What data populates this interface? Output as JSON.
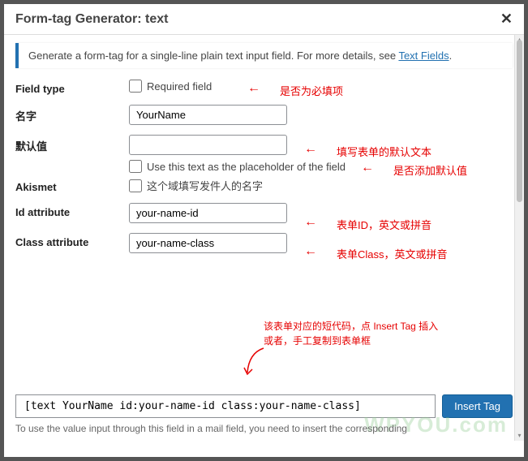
{
  "dialog": {
    "title": "Form-tag Generator: text",
    "close": "✕"
  },
  "notice": {
    "text": "Generate a form-tag for a single-line plain text input field. For more details, see ",
    "link": "Text Fields",
    "suffix": "."
  },
  "fields": {
    "fieldtype": {
      "label": "Field type",
      "checkbox_label": "Required field"
    },
    "name": {
      "label": "名字",
      "value": "YourName"
    },
    "default": {
      "label": "默认值",
      "value": "",
      "placeholder_checkbox": "Use this text as the placeholder of the field"
    },
    "akismet": {
      "label": "Akismet",
      "checkbox_label": "这个域填写发件人的名字"
    },
    "idattr": {
      "label": "Id attribute",
      "value": "your-name-id"
    },
    "classattr": {
      "label": "Class attribute",
      "value": "your-name-class"
    }
  },
  "annotations": {
    "required": "是否为必填项",
    "default_text": "填写表单的默认文本",
    "placeholder": "是否添加默认值",
    "id": "表单ID，英文或拼音",
    "class": "表单Class，英文或拼音",
    "shortcode_line1": "该表单对应的短代码，点 Insert Tag 插入",
    "shortcode_line2": "或者，手工复制到表单框"
  },
  "footer": {
    "tag": "[text YourName id:your-name-id class:your-name-class]",
    "button": "Insert Tag"
  },
  "cutoff_text": "To use the value input through this field in a mail field, you need to insert the corresponding",
  "watermark": "WPYOU.com"
}
